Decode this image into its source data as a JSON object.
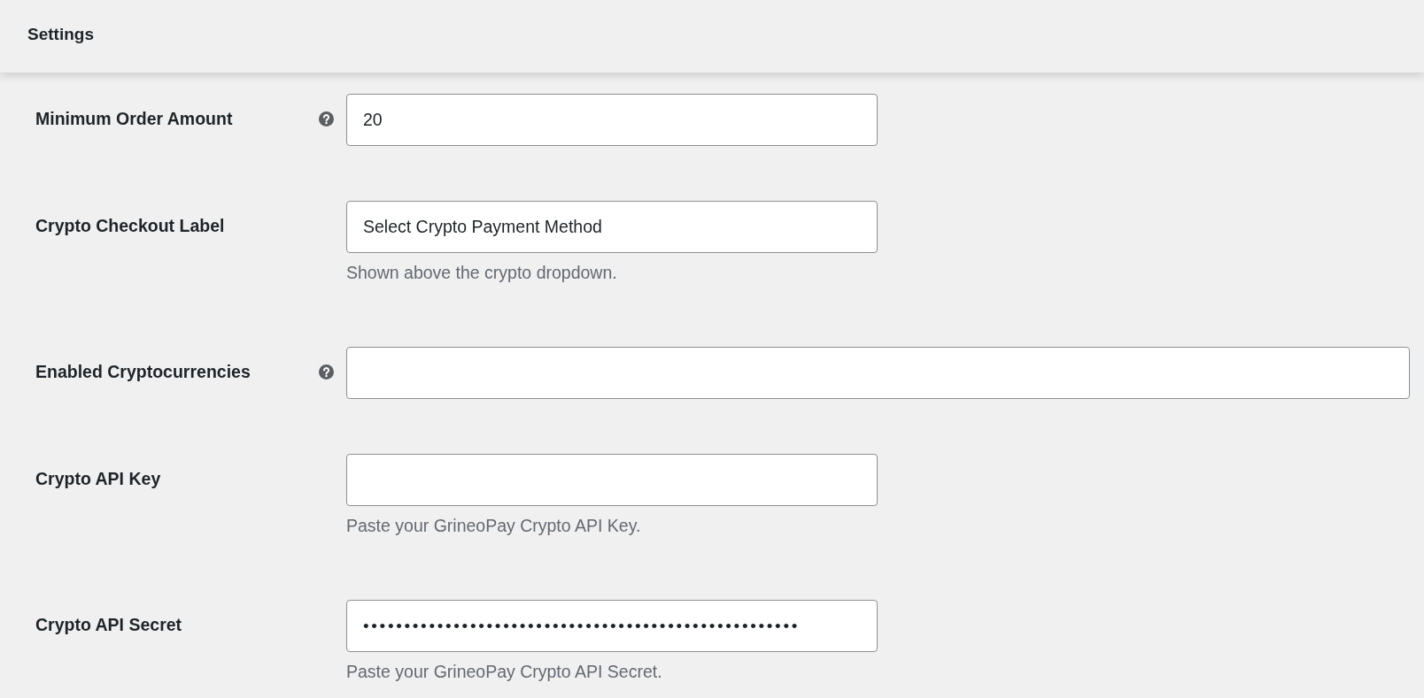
{
  "header": {
    "title": "Settings"
  },
  "fields": [
    {
      "label": "Minimum Order Amount",
      "help": true,
      "kind": "text",
      "value": "20"
    },
    {
      "label": "Crypto Checkout Label",
      "help": false,
      "kind": "text",
      "value": "Select Crypto Payment Method",
      "description": "Shown above the crypto dropdown."
    },
    {
      "label": "Enabled Cryptocurrencies",
      "help": true,
      "kind": "multiselect"
    },
    {
      "label": "Crypto API Key",
      "help": false,
      "kind": "text",
      "description": "Paste your GrineoPay Crypto API Key."
    },
    {
      "label": "Crypto API Secret",
      "help": false,
      "kind": "password",
      "value": "•••••••••••••••••••••••••••••••••••••••••••••••••••••",
      "description": "Paste your GrineoPay Crypto API Secret."
    }
  ]
}
